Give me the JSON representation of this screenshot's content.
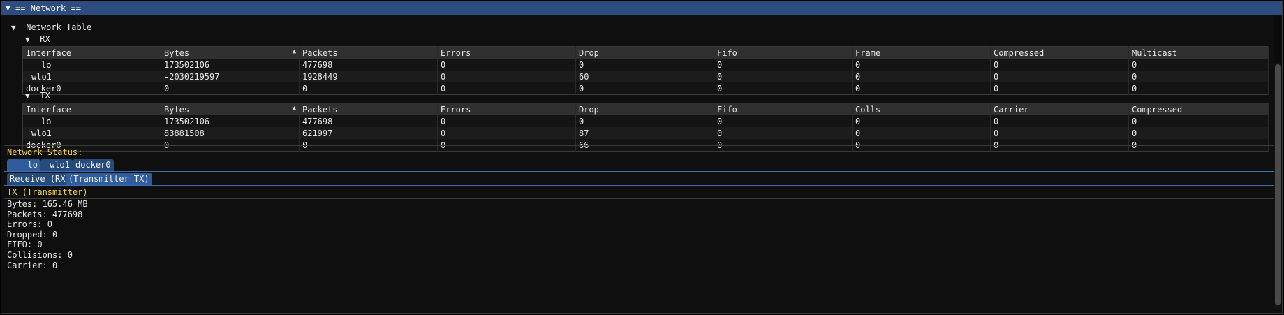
{
  "window": {
    "title": "== Network =="
  },
  "tree": {
    "table_node": "Network Table",
    "rx_node": "RX",
    "tx_node": "TX"
  },
  "rx": {
    "headers": [
      "Interface",
      "Bytes",
      "Packets",
      "Errors",
      "Drop",
      "Fifo",
      "Frame",
      "Compressed",
      "Multicast"
    ],
    "rows": [
      [
        "lo",
        "173502106",
        "477698",
        "0",
        "0",
        "0",
        "0",
        "0",
        "0"
      ],
      [
        "wlo1",
        "-2030219597",
        "1928449",
        "0",
        "60",
        "0",
        "0",
        "0",
        "0"
      ],
      [
        "docker0",
        "0",
        "0",
        "0",
        "0",
        "0",
        "0",
        "0",
        "0"
      ]
    ]
  },
  "tx": {
    "headers": [
      "Interface",
      "Bytes",
      "Packets",
      "Errors",
      "Drop",
      "Fifo",
      "Colls",
      "Carrier",
      "Compressed"
    ],
    "rows": [
      [
        "lo",
        "173502106",
        "477698",
        "0",
        "0",
        "0",
        "0",
        "0",
        "0"
      ],
      [
        "wlo1",
        "83881508",
        "621997",
        "0",
        "87",
        "0",
        "0",
        "0",
        "0"
      ],
      [
        "docker0",
        "0",
        "0",
        "0",
        "66",
        "0",
        "0",
        "0",
        "0"
      ]
    ]
  },
  "status": {
    "label": "Network Status:",
    "interfaces": [
      "lo",
      "wlo1",
      "docker0"
    ],
    "modes": [
      "Receive (RX)",
      "(Transmitter TX)"
    ],
    "section_title": "TX (Transmitter)",
    "details": [
      "Bytes: 165.46 MB",
      "Packets: 477698",
      "Errors: 0",
      "Dropped: 0",
      "FIFO: 0",
      "Collisions: 0",
      "Carrier: 0"
    ]
  },
  "colors": {
    "title_bar": "#2e4d7f",
    "tab_active": "#2f5d9b",
    "highlight_text": "#f0d050"
  }
}
